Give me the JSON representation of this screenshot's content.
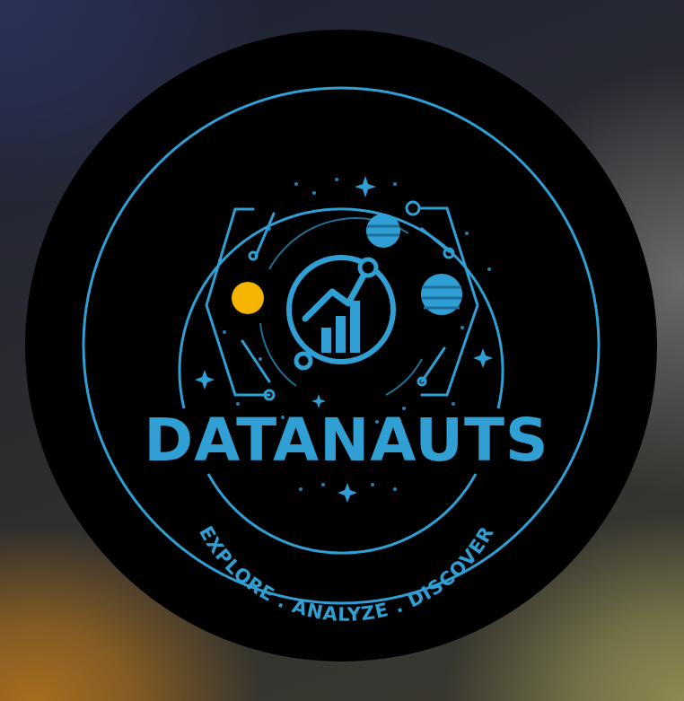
{
  "logo": {
    "title": "DATANAUTS",
    "tagline": "EXPLORE . ANALYZE . DISCOVER"
  },
  "colors": {
    "accent": "#2f9fd4",
    "sun": "#f4b400",
    "disc": "#000000"
  },
  "icons": [
    "chart-growth-icon",
    "sun-icon",
    "planet-icon",
    "circuit-icon",
    "star-icon"
  ]
}
